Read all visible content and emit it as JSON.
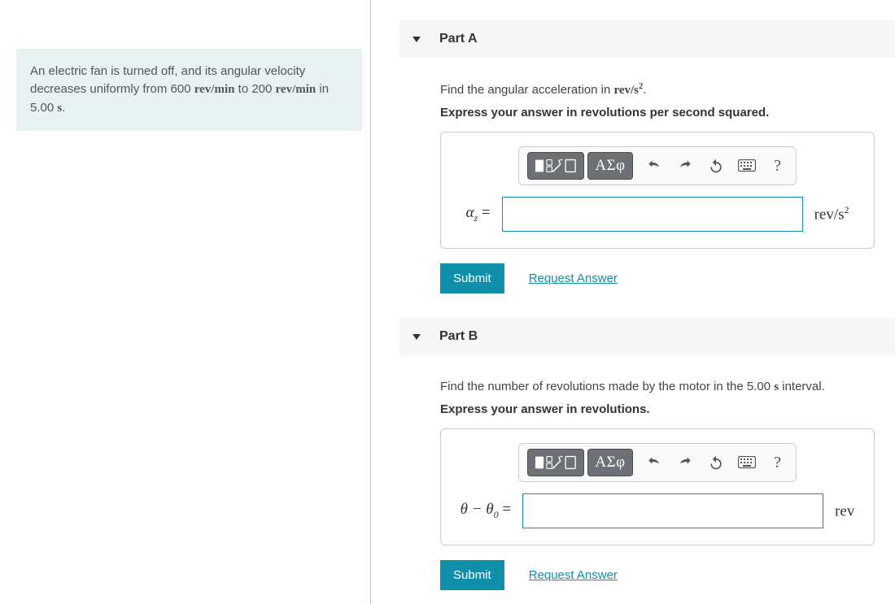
{
  "problem": {
    "t1": "An electric fan is turned off, and its angular velocity decreases uniformly from 600 ",
    "u1": "rev/min",
    "t2": " to 200 ",
    "u2": "rev/min",
    "t3": " in 5.00 ",
    "u3": "s",
    "t4": "."
  },
  "partA": {
    "title": "Part A",
    "prompt_pre": "Find the angular acceleration in ",
    "prompt_unit_html": "rev/s",
    "prompt_sup": "2",
    "prompt_post": ".",
    "instruction": "Express your answer in revolutions per second squared.",
    "var": "α",
    "var_sub": "z",
    "eq": " =",
    "value": "",
    "unit_html": "rev/s",
    "unit_sup": "2",
    "submit": "Submit",
    "request": "Request Answer"
  },
  "partB": {
    "title": "Part B",
    "prompt_pre": "Find the number of revolutions made by the motor in the 5.00 ",
    "prompt_unit_html": "s",
    "prompt_post": " interval.",
    "instruction": "Express your answer in revolutions.",
    "var": "θ − θ",
    "var_sub": "0",
    "eq": " =",
    "value": "",
    "unit_html": "rev",
    "unit_sup": "",
    "submit": "Submit",
    "request": "Request Answer"
  },
  "toolbar": {
    "templates": "templates",
    "greek": "ΑΣφ",
    "undo": "undo",
    "redo": "redo",
    "reset": "reset",
    "keyboard": "keyboard",
    "help": "?"
  }
}
